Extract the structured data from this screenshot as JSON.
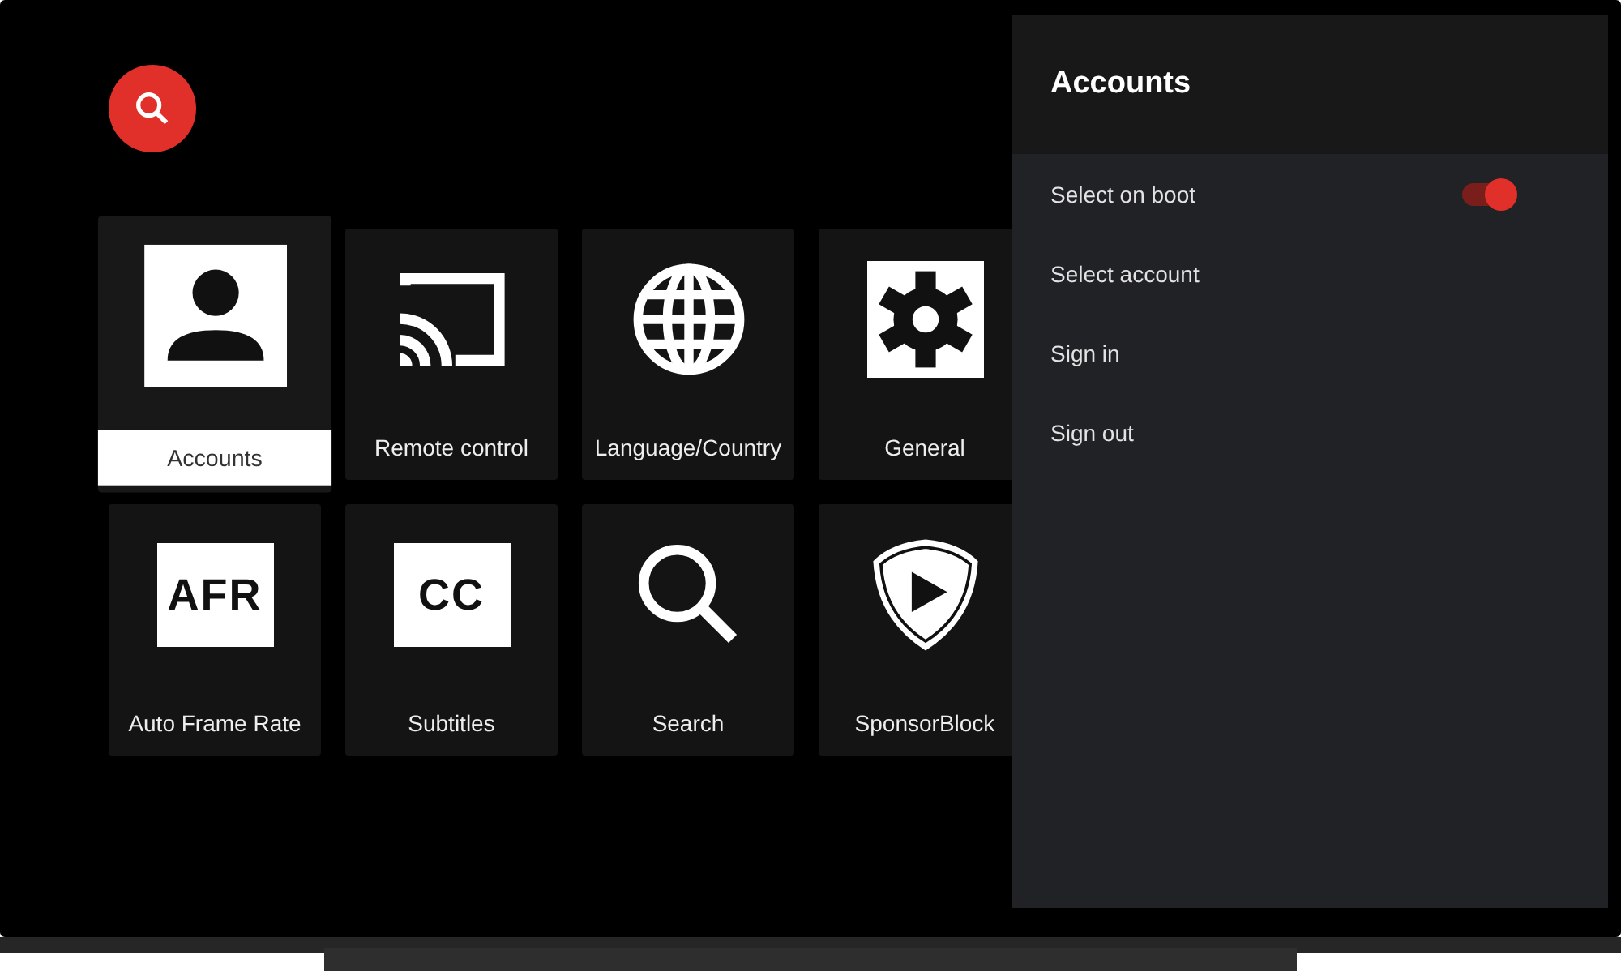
{
  "search_button": {
    "kind": "search"
  },
  "tiles": [
    {
      "kind": "person",
      "label": "Accounts",
      "selected": true
    },
    {
      "kind": "cast",
      "label": "Remote control",
      "selected": false
    },
    {
      "kind": "globe",
      "label": "Language/Country",
      "selected": false
    },
    {
      "kind": "gear",
      "label": "General",
      "selected": false
    },
    {
      "kind": "badge",
      "icon_text": "AFR",
      "label": "Auto Frame Rate",
      "selected": false
    },
    {
      "kind": "badge",
      "icon_text": "CC",
      "label": "Subtitles",
      "selected": false
    },
    {
      "kind": "search",
      "label": "Search",
      "selected": false
    },
    {
      "kind": "shield",
      "label": "SponsorBlock",
      "selected": false
    }
  ],
  "panel": {
    "title": "Accounts",
    "items": [
      {
        "kind": "toggle",
        "label": "Select on boot",
        "on": true
      },
      {
        "kind": "plain",
        "label": "Select account"
      },
      {
        "kind": "plain",
        "label": "Sign in"
      },
      {
        "kind": "plain",
        "label": "Sign out"
      }
    ]
  }
}
